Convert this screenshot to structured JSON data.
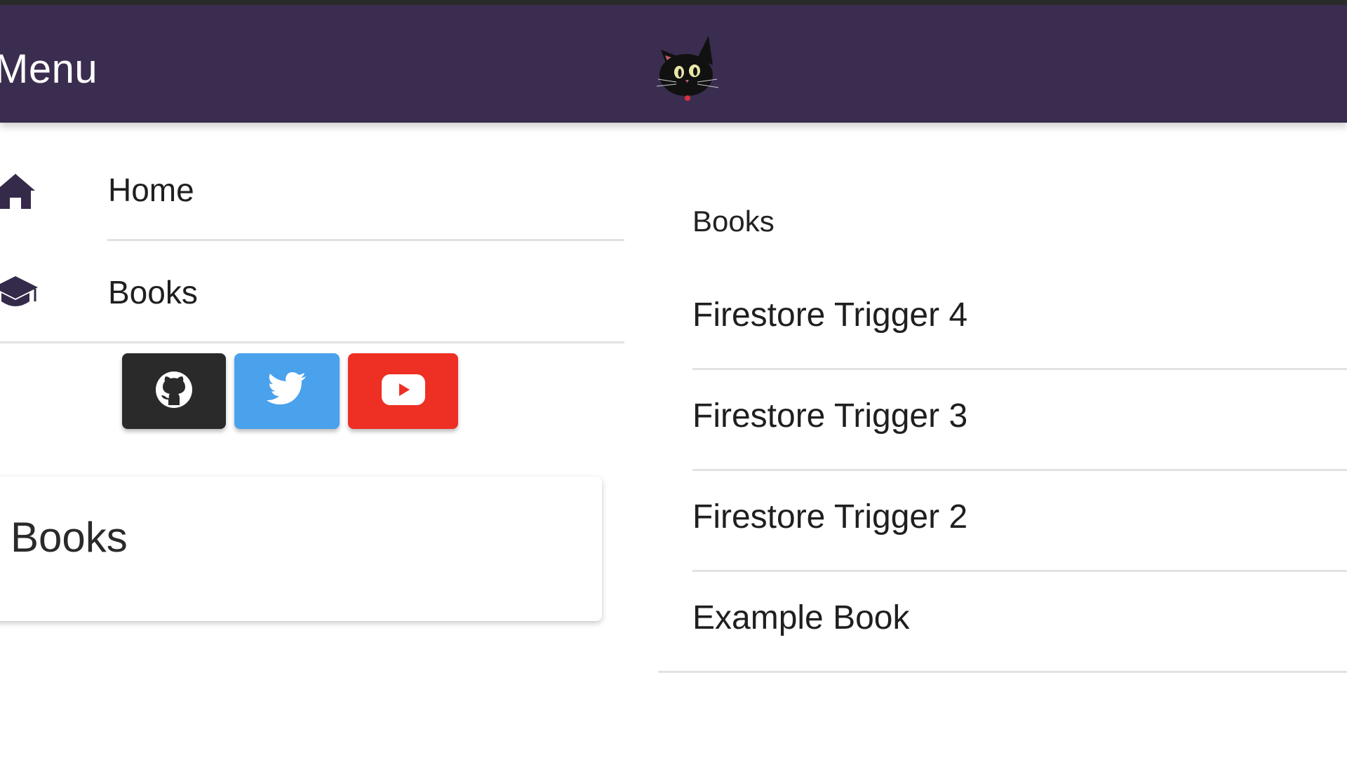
{
  "appbar": {
    "title": "Menu",
    "logo_icon": "cat-face-icon",
    "background": "#3b2d4f"
  },
  "nav": {
    "items": [
      {
        "label": "Home",
        "icon": "home-icon"
      },
      {
        "label": "Books",
        "icon": "graduation-cap-icon"
      }
    ]
  },
  "social": {
    "buttons": [
      {
        "name": "github",
        "icon": "github-icon",
        "color": "#2a2a2a"
      },
      {
        "name": "twitter",
        "icon": "twitter-bird-icon",
        "color": "#4aa1ec"
      },
      {
        "name": "youtube",
        "icon": "youtube-play-icon",
        "color": "#ee2f23"
      }
    ]
  },
  "card": {
    "title": "Books"
  },
  "books_list": {
    "header": "Books",
    "items": [
      "Firestore Trigger 4",
      "Firestore Trigger 3",
      "Firestore Trigger 2",
      "Example Book"
    ]
  }
}
